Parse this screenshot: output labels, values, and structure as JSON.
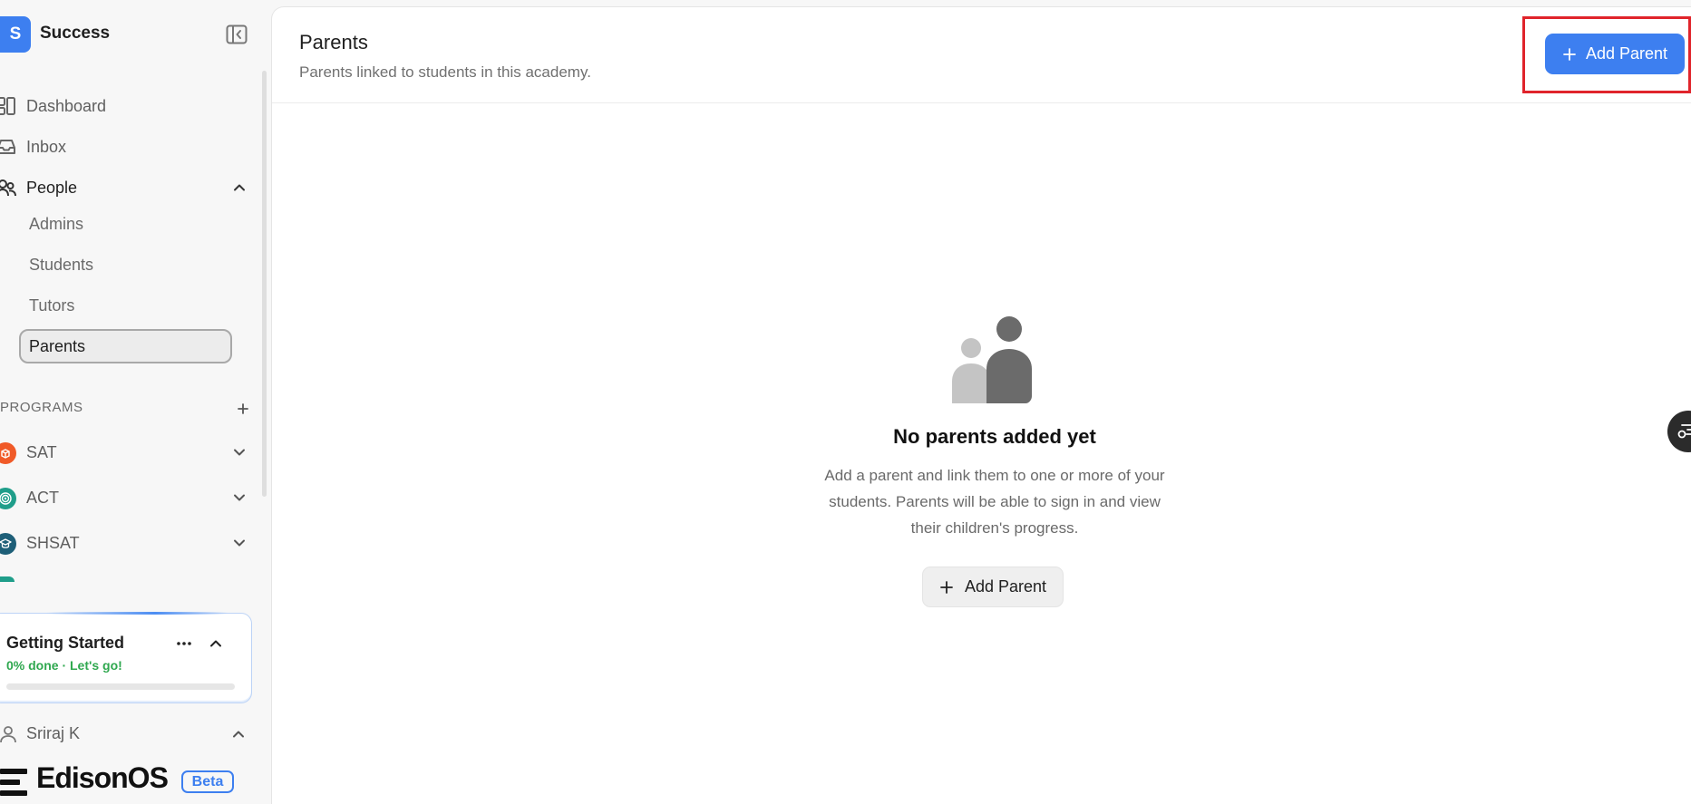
{
  "workspace": {
    "initial": "S",
    "name": "Success"
  },
  "nav": {
    "dashboard": "Dashboard",
    "inbox": "Inbox",
    "people": "People",
    "people_items": [
      "Admins",
      "Students",
      "Tutors",
      "Parents"
    ],
    "active_item": "Parents"
  },
  "programs": {
    "label": "PROGRAMS",
    "items": [
      {
        "name": "SAT",
        "color": "#f05a28"
      },
      {
        "name": "ACT",
        "color": "#1f9e8a"
      },
      {
        "name": "SHSAT",
        "color": "#1e5f78"
      }
    ]
  },
  "getting_started": {
    "title": "Getting Started",
    "status": "0% done · Let's go!",
    "progress_percent": 0
  },
  "user": {
    "name": "Sriraj K"
  },
  "brand": {
    "name": "EdisonOS",
    "badge": "Beta"
  },
  "page": {
    "title": "Parents",
    "subtitle": "Parents linked to students in this academy.",
    "primary_action": "Add Parent"
  },
  "empty_state": {
    "title": "No parents added yet",
    "description": "Add a parent and link them to one or more of your students. Parents will be able to sign in and view their children's progress.",
    "action": "Add Parent"
  },
  "colors": {
    "accent": "#3d7ff0",
    "success": "#2fa84f",
    "highlight": "#e0242b"
  }
}
